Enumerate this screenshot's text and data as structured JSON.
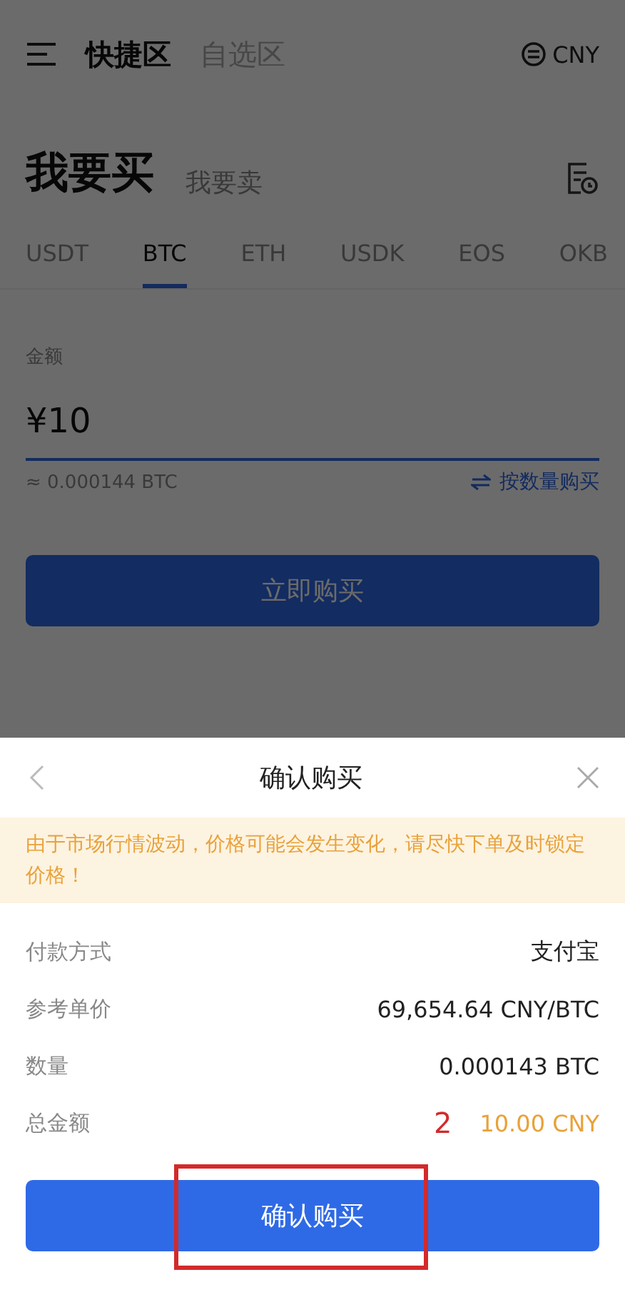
{
  "top_bar": {
    "tabs": [
      {
        "label": "快捷区",
        "selected": true
      },
      {
        "label": "自选区",
        "selected": false
      }
    ],
    "currency": "CNY"
  },
  "mode_tabs": [
    {
      "label": "我要买",
      "selected": true
    },
    {
      "label": "我要卖",
      "selected": false
    }
  ],
  "coin_tabs": [
    {
      "label": "USDT",
      "selected": false
    },
    {
      "label": "BTC",
      "selected": true
    },
    {
      "label": "ETH",
      "selected": false
    },
    {
      "label": "USDK",
      "selected": false
    },
    {
      "label": "EOS",
      "selected": false
    },
    {
      "label": "OKB",
      "selected": false
    }
  ],
  "amount": {
    "label": "金额",
    "value": "¥10",
    "estimate": "≈ 0.000144 BTC",
    "switch_link": "按数量购买"
  },
  "buy_button": "立即购买",
  "dialog": {
    "title": "确认购买",
    "warning": "由于市场行情波动，价格可能会发生变化，请尽快下单及时锁定价格！",
    "rows": [
      {
        "label": "付款方式",
        "value": "支付宝",
        "highlight": false
      },
      {
        "label": "参考单价",
        "value": "69,654.64 CNY/BTC",
        "highlight": false
      },
      {
        "label": "数量",
        "value": "0.000143 BTC",
        "highlight": false
      },
      {
        "label": "总金额",
        "value": "10.00 CNY",
        "highlight": true
      }
    ],
    "confirm_button": "确认购买"
  },
  "annotation": {
    "number": "2"
  }
}
